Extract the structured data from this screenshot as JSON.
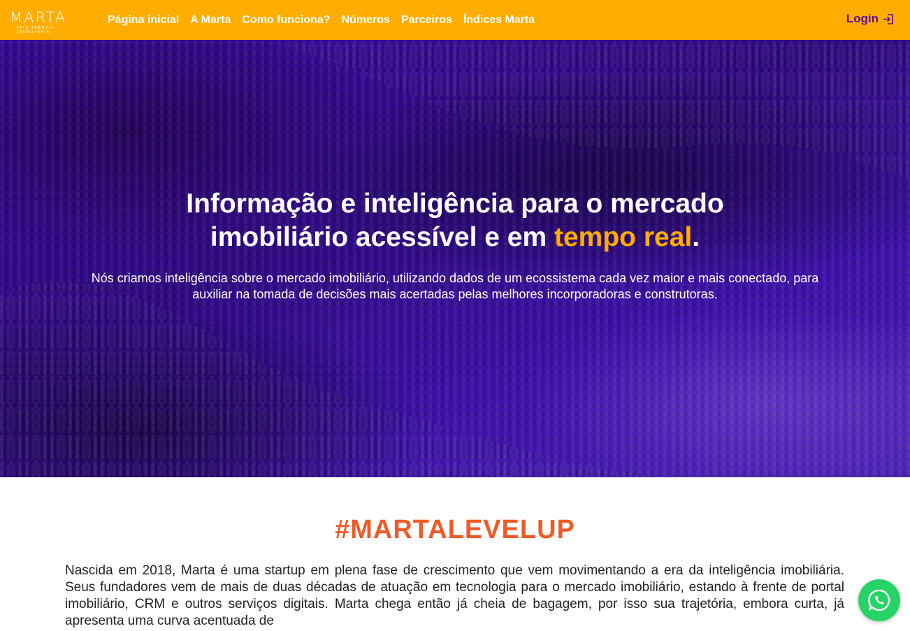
{
  "brand": {
    "name": "MARTA",
    "tagline": "INTELIGÊNCIA IMOBILIÁRIA"
  },
  "nav": {
    "items": [
      {
        "label": "Página inicial"
      },
      {
        "label": "A Marta"
      },
      {
        "label": "Como funciona?"
      },
      {
        "label": "Números"
      },
      {
        "label": "Parceiros"
      },
      {
        "label": "Índices Marta"
      }
    ],
    "login_label": "Login",
    "login_icon": "login-icon"
  },
  "hero": {
    "title_line1": "Informação e inteligência para o mercado",
    "title_line2_prefix": "imobiliário acessível e em ",
    "title_highlight": "tempo real",
    "title_suffix": ".",
    "subtitle": "Nós criamos inteligência sobre o mercado imobiliário, utilizando dados de um ecossistema cada vez maior e mais conectado, para auxiliar na tomada de decisões mais acertadas pelas melhores incorporadoras e construtoras."
  },
  "about": {
    "heading": "#MARTALEVELUP",
    "body": "Nascida em 2018, Marta é uma startup em plena fase de crescimento que vem movimentando a era da inteligência imobiliária. Seus fundadores vem de mais de duas décadas de atuação em tecnologia para o mercado imobiliário, estando à frente de portal imobiliário, CRM e outros serviços digitais. Marta chega então já cheia de bagagem, por isso sua trajetória, embora curta, já apresenta uma curva acentuada de"
  },
  "floating": {
    "whatsapp_icon": "whatsapp-icon"
  },
  "colors": {
    "nav_bg": "#ffad00",
    "accent_orange": "#ffad00",
    "login_purple": "#5a0f9a",
    "hero_purple": "#3c0aa0",
    "heading_orange": "#f05a28",
    "whatsapp_green": "#25d366"
  }
}
